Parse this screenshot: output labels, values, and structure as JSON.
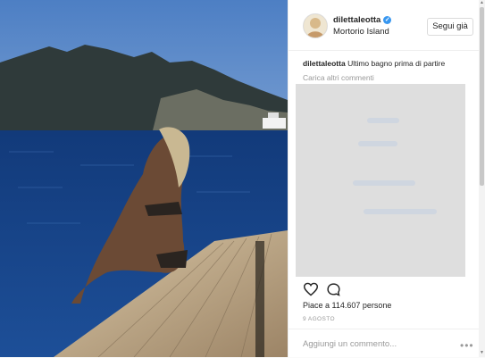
{
  "post": {
    "username": "dilettaleotta",
    "location": "Mortorio Island",
    "follow_label": "Segui già",
    "caption_user": "dilettaleotta",
    "caption_text": "Ultimo bagno prima di partire",
    "load_more_label": "Carica altri commenti",
    "likes_label": "Piace a 114.607 persone",
    "date_label": "9 AGOSTO",
    "add_comment_placeholder": "Aggiungi un commento...",
    "options_label": "•••"
  },
  "icons": {
    "verified": "verified-badge-icon",
    "like": "heart-icon",
    "comment": "comment-bubble-icon",
    "options": "more-options-icon"
  },
  "colors": {
    "verified": "#3897f0",
    "text": "#262626",
    "muted": "#999999"
  }
}
